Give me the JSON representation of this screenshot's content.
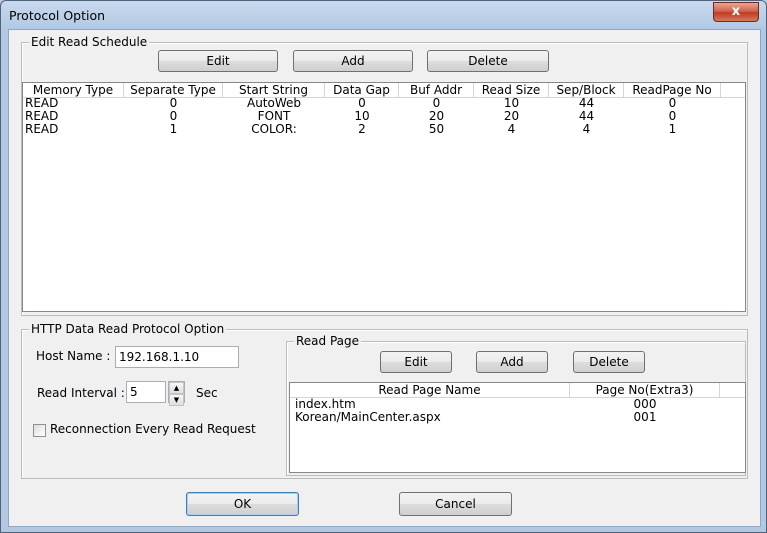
{
  "window": {
    "title": "Protocol Option",
    "close_glyph": "x"
  },
  "schedule": {
    "group_label": "Edit Read Schedule",
    "edit_label": "Edit",
    "add_label": "Add",
    "delete_label": "Delete",
    "columns": [
      "Memory Type",
      "Separate Type",
      "Start String",
      "Data Gap",
      "Buf Addr",
      "Read Size",
      "Sep/Block",
      "ReadPage No"
    ],
    "rows": [
      [
        "READ",
        "0",
        "AutoWeb",
        "0",
        "0",
        "10",
        "44",
        "0"
      ],
      [
        "READ",
        "0",
        "FONT",
        "10",
        "20",
        "20",
        "44",
        "0"
      ],
      [
        "READ",
        "1",
        "COLOR:",
        "2",
        "50",
        "4",
        "4",
        "1"
      ]
    ]
  },
  "http": {
    "group_label": "HTTP Data Read Protocol Option",
    "host_label": "Host Name :",
    "host_value": "192.168.1.10",
    "interval_label": "Read Interval :",
    "interval_value": "5",
    "interval_unit": "Sec",
    "reconnect_label": "Reconnection Every Read Request",
    "reconnect_checked": false
  },
  "read_page": {
    "group_label": "Read Page",
    "edit_label": "Edit",
    "add_label": "Add",
    "delete_label": "Delete",
    "columns": [
      "Read Page Name",
      "Page No(Extra3)"
    ],
    "rows": [
      [
        "index.htm",
        "000"
      ],
      [
        "Korean/MainCenter.aspx",
        "001"
      ]
    ]
  },
  "footer": {
    "ok_label": "OK",
    "cancel_label": "Cancel"
  },
  "icons": {
    "spin_up": "up-arrow-icon",
    "spin_down": "down-arrow-icon"
  }
}
